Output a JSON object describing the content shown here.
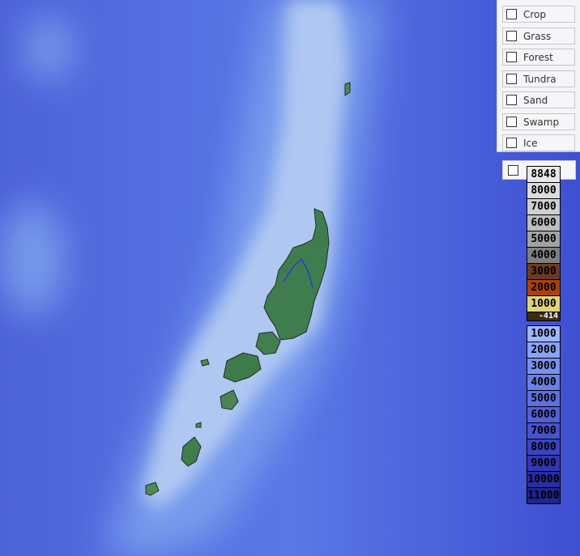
{
  "land_cover": {
    "items": [
      {
        "label": "Crop",
        "checked": false
      },
      {
        "label": "Grass",
        "checked": false
      },
      {
        "label": "Forest",
        "checked": false
      },
      {
        "label": "Tundra",
        "checked": false
      },
      {
        "label": "Sand",
        "checked": false
      },
      {
        "label": "Swamp",
        "checked": false
      },
      {
        "label": "Ice",
        "checked": false
      }
    ]
  },
  "elevation_legend": {
    "checked": false,
    "levels": [
      {
        "label": "8848",
        "color": "#e8e8e8",
        "text": "#000"
      },
      {
        "label": "8000",
        "color": "#dcdcdc",
        "text": "#000"
      },
      {
        "label": "7000",
        "color": "#cfcfcf",
        "text": "#000"
      },
      {
        "label": "6000",
        "color": "#bdbdbd",
        "text": "#000"
      },
      {
        "label": "5000",
        "color": "#a3a3a3",
        "text": "#000"
      },
      {
        "label": "4000",
        "color": "#7f7f7f",
        "text": "#000"
      },
      {
        "label": "3000",
        "color": "#6a3a24",
        "text": "#000"
      },
      {
        "label": "2000",
        "color": "#a8420e",
        "text": "#000"
      },
      {
        "label": "1000",
        "color": "#dfd27a",
        "text": "#000"
      },
      {
        "label": "-414",
        "color": "#3b2a12",
        "text": "#fff"
      }
    ]
  },
  "depth_legend": {
    "levels": [
      {
        "label": "1000",
        "color": "#9fb6ff"
      },
      {
        "label": "2000",
        "color": "#8aa3f6"
      },
      {
        "label": "3000",
        "color": "#7a90ef"
      },
      {
        "label": "4000",
        "color": "#6c7fe8"
      },
      {
        "label": "5000",
        "color": "#5e6fe0"
      },
      {
        "label": "6000",
        "color": "#5260d8"
      },
      {
        "label": "7000",
        "color": "#4652cd"
      },
      {
        "label": "8000",
        "color": "#3b44bf"
      },
      {
        "label": "9000",
        "color": "#3137b0"
      },
      {
        "label": "10000",
        "color": "#282d9f"
      },
      {
        "label": "11000",
        "color": "#20248c"
      }
    ]
  },
  "colors": {
    "ocean_deep": "#4a5fd8",
    "ocean_shelf": "#a9c4ef",
    "land": "#3f7d4e",
    "river": "#1f3fd0"
  }
}
